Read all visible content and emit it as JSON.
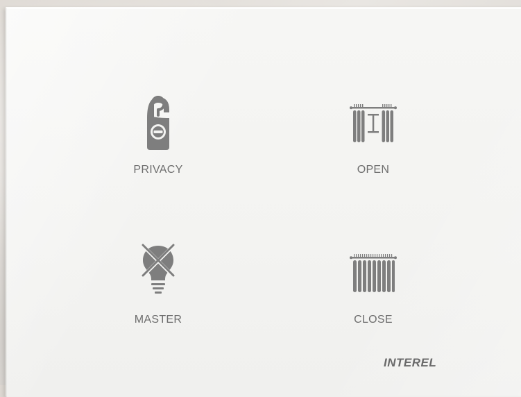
{
  "keys": [
    {
      "id": "privacy",
      "label": "PRIVACY",
      "icon": "do-not-disturb-hanger-icon"
    },
    {
      "id": "open",
      "label": "OPEN",
      "icon": "curtain-open-icon"
    },
    {
      "id": "master",
      "label": "MASTER",
      "icon": "light-bulb-off-icon"
    },
    {
      "id": "close",
      "label": "CLOSE",
      "icon": "curtain-close-icon"
    }
  ],
  "brand": "INTEREL",
  "colors": {
    "panel": "#f4f4f2",
    "engraving": "#6d6d6d",
    "wall": "#e0dcd7"
  }
}
